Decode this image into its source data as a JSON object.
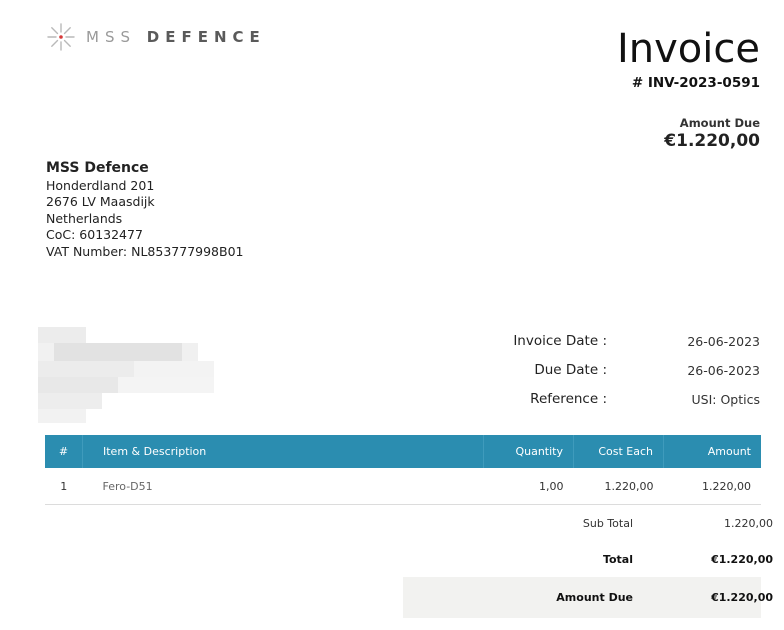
{
  "logo": {
    "text_light": "MSS",
    "text_bold": "DEFENCE",
    "icon": "starburst-icon",
    "accent": "#d63a3a"
  },
  "invoice": {
    "title": "Invoice",
    "number": "# INV-2023-0591",
    "amount_due_label": "Amount Due",
    "amount_due": "€1.220,00"
  },
  "company": {
    "name": "MSS Defence",
    "lines": [
      "Honderdland 201",
      "2676 LV Maasdijk",
      "Netherlands",
      "CoC: 60132477",
      "VAT Number: NL853777998B01"
    ]
  },
  "meta": [
    {
      "label": "Invoice Date :",
      "value": "26-06-2023"
    },
    {
      "label": "Due Date :",
      "value": "26-06-2023"
    },
    {
      "label": "Reference :",
      "value": "USI: Optics"
    }
  ],
  "table": {
    "headers": [
      "#",
      "Item & Description",
      "Quantity",
      "Cost Each",
      "Amount"
    ],
    "rows": [
      [
        "1",
        "Fero-D51",
        "1,00",
        "1.220,00",
        "1.220,00"
      ]
    ]
  },
  "totals": {
    "subtotal_label": "Sub Total",
    "subtotal": "1.220,00",
    "total_label": "Total",
    "total": "€1.220,00",
    "amount_due_label": "Amount Due",
    "amount_due": "€1.220,00"
  },
  "colors": {
    "header_bg": "#2b8db0",
    "amount_due_bg": "#f2f2f0"
  }
}
